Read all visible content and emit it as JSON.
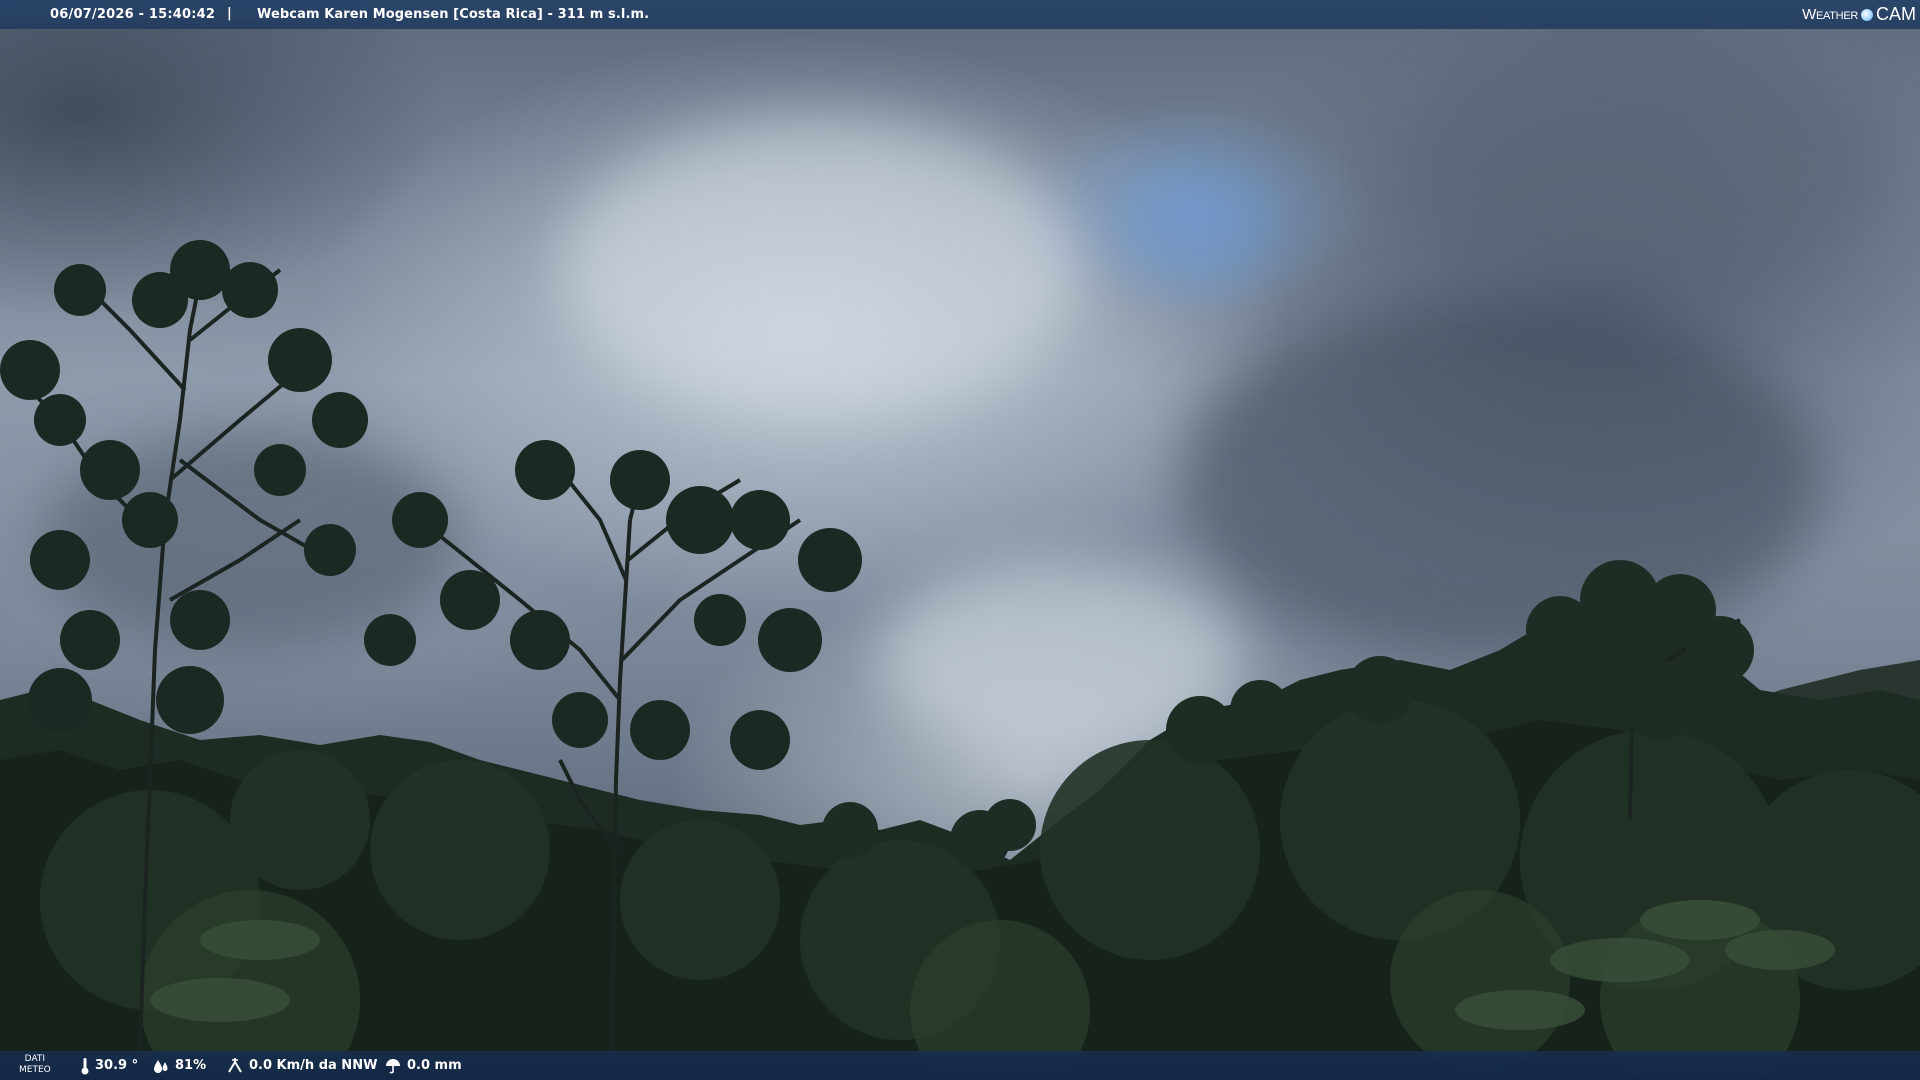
{
  "header": {
    "datetime": "06/07/2026 - 15:40:42",
    "separator": "|",
    "location": "Webcam Karen Mogensen [Costa Rica] - 311 m s.l.m.",
    "brand_weather": "Weather",
    "brand_cam": "CAM",
    "brand_icon": "globe-icon"
  },
  "footer": {
    "label_line1": "DATI",
    "label_line2": "METEO",
    "temperature": "30.9 °",
    "temperature_icon": "thermometer-icon",
    "humidity": "81%",
    "humidity_icon": "humidity-drop-icon",
    "wind": "0.0 Km/h da NNW",
    "wind_icon": "wind-icon",
    "rain": "0.0 mm",
    "rain_icon": "rain-umbrella-icon"
  },
  "colors": {
    "bar_background": "#203a5e",
    "text": "#ffffff",
    "foliage_dark": "#141d1a",
    "foliage_mid": "#1f2e22",
    "sky_blue_patch": "#7aa0d2"
  }
}
